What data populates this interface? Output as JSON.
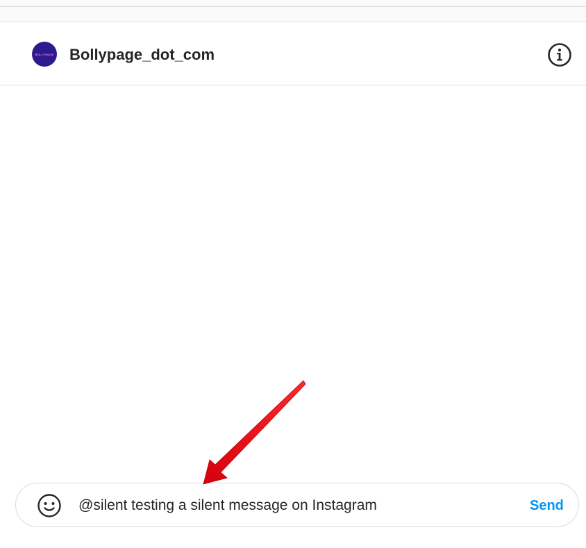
{
  "header": {
    "username": "Bollypage_dot_com",
    "avatar_logo_text": "BOLLYPAGE"
  },
  "icons": {
    "avatar": "profile-avatar",
    "info": "info-icon",
    "emoji": "emoji-icon",
    "annotation": "red-arrow-icon"
  },
  "composer": {
    "message_value": "@silent testing a silent message on Instagram",
    "send_label": "Send"
  },
  "colors": {
    "accent": "#0095f6",
    "avatar_bg": "#2b1b8f",
    "arrow": "#e8101a",
    "text": "#262626",
    "border": "#dbdbdb"
  }
}
